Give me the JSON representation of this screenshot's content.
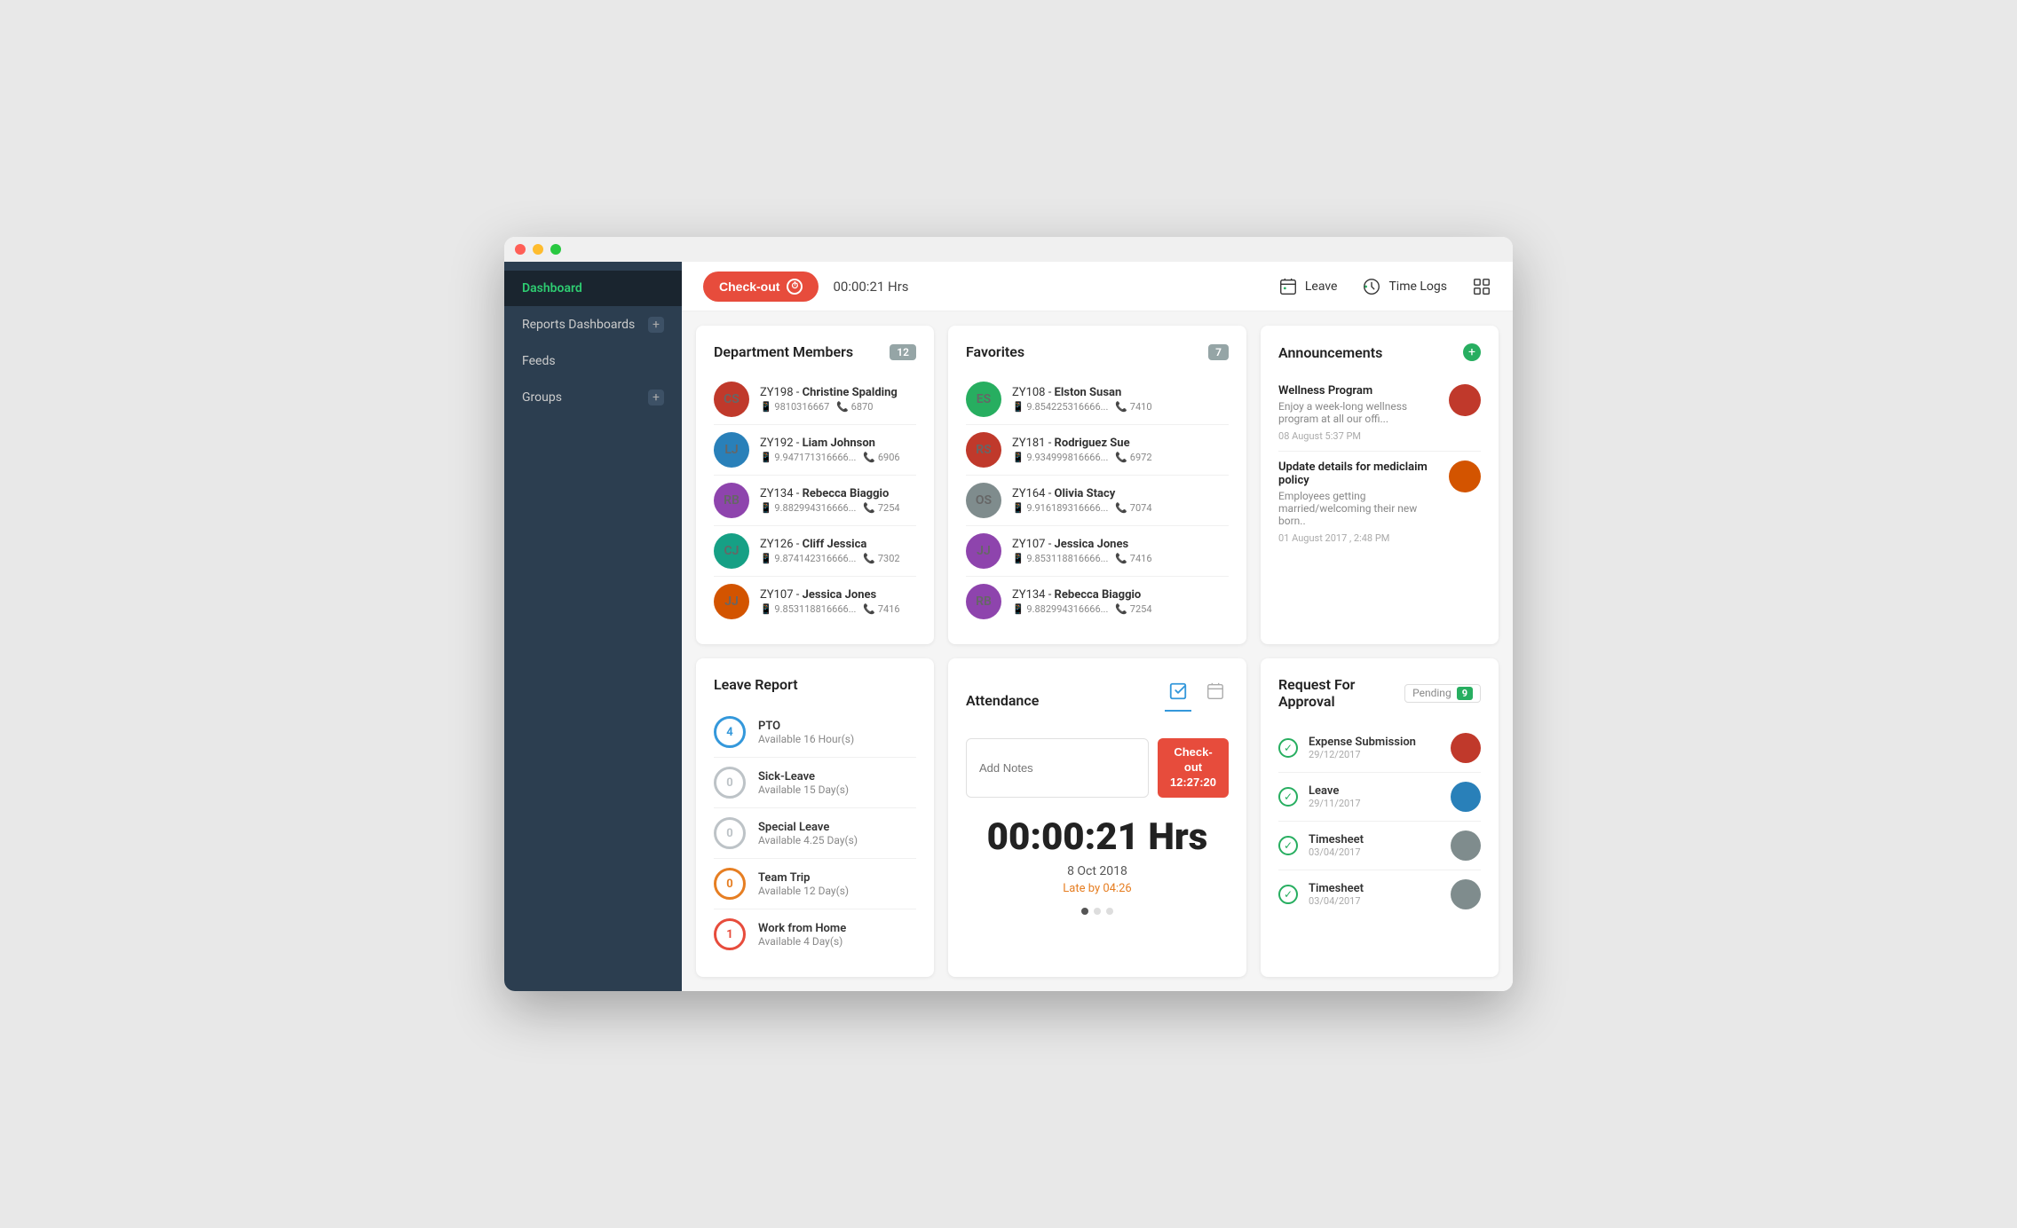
{
  "window": {
    "title": "Dashboard"
  },
  "header": {
    "checkout_label": "Check-out",
    "time_display": "00:00:21 Hrs",
    "leave_label": "Leave",
    "timelogs_label": "Time Logs"
  },
  "sidebar": {
    "items": [
      {
        "id": "dashboard",
        "label": "Dashboard",
        "active": true,
        "plus": false
      },
      {
        "id": "reports",
        "label": "Reports Dashboards",
        "active": false,
        "plus": true
      },
      {
        "id": "feeds",
        "label": "Feeds",
        "active": false,
        "plus": false
      },
      {
        "id": "groups",
        "label": "Groups",
        "active": false,
        "plus": true
      }
    ]
  },
  "department_members": {
    "title": "Department Members",
    "count": 12,
    "members": [
      {
        "id": "ZY198",
        "name": "Christine Spalding",
        "phone": "9810316667",
        "ext": "6870"
      },
      {
        "id": "ZY192",
        "name": "Liam Johnson",
        "phone": "9.947171316666...",
        "ext": "6906"
      },
      {
        "id": "ZY134",
        "name": "Rebecca Biaggio",
        "phone": "9.882994316666...",
        "ext": "7254"
      },
      {
        "id": "ZY126",
        "name": "Cliff Jessica",
        "phone": "9.874142316666...",
        "ext": "7302"
      },
      {
        "id": "ZY107",
        "name": "Jessica Jones",
        "phone": "9.853118816666...",
        "ext": "7416"
      }
    ]
  },
  "favorites": {
    "title": "Favorites",
    "count": 7,
    "members": [
      {
        "id": "ZY108",
        "name": "Elston Susan",
        "phone": "9.854225316666...",
        "ext": "7410"
      },
      {
        "id": "ZY181",
        "name": "Rodriguez Sue",
        "phone": "9.934999816666...",
        "ext": "6972"
      },
      {
        "id": "ZY164",
        "name": "Olivia Stacy",
        "phone": "9.916189316666...",
        "ext": "7074"
      },
      {
        "id": "ZY107",
        "name": "Jessica Jones",
        "phone": "9.853118816666...",
        "ext": "7416"
      },
      {
        "id": "ZY134",
        "name": "Rebecca Biaggio",
        "phone": "9.882994316666...",
        "ext": "7254"
      }
    ]
  },
  "announcements": {
    "title": "Announcements",
    "items": [
      {
        "title": "Wellness Program",
        "desc": "Enjoy a week-long wellness program at all our offi...",
        "time": "08 August 5:37 PM"
      },
      {
        "title": "Update details for mediclaim policy",
        "desc": "Employees getting married/welcoming their new born..",
        "time": "01 August 2017 , 2:48 PM"
      }
    ]
  },
  "leave_report": {
    "title": "Leave Report",
    "items": [
      {
        "label": "PTO",
        "available": "Available 16 Hour(s)",
        "count": "4",
        "color": "blue"
      },
      {
        "label": "Sick-Leave",
        "available": "Available 15 Day(s)",
        "count": "0",
        "color": "gray"
      },
      {
        "label": "Special Leave",
        "available": "Available 4.25 Day(s)",
        "count": "0",
        "color": "gray"
      },
      {
        "label": "Team Trip",
        "available": "Available 12 Day(s)",
        "count": "0",
        "color": "orange"
      },
      {
        "label": "Work from Home",
        "available": "Available 4 Day(s)",
        "count": "1",
        "color": "red"
      }
    ]
  },
  "attendance": {
    "title": "Attendance",
    "notes_placeholder": "Add Notes",
    "checkout_label": "Check-out",
    "checkout_time": "12:27:20",
    "big_time": "00:00:21 Hrs",
    "date": "8 Oct 2018",
    "late_label": "Late by 04:26"
  },
  "request_approval": {
    "title": "Request For Approval",
    "pending_label": "Pending",
    "pending_count": "9",
    "items": [
      {
        "type": "Expense Submission",
        "date": "29/12/2017"
      },
      {
        "type": "Leave",
        "date": "29/11/2017"
      },
      {
        "type": "Timesheet",
        "date": "03/04/2017"
      },
      {
        "type": "Timesheet",
        "date": "03/04/2017"
      }
    ]
  }
}
